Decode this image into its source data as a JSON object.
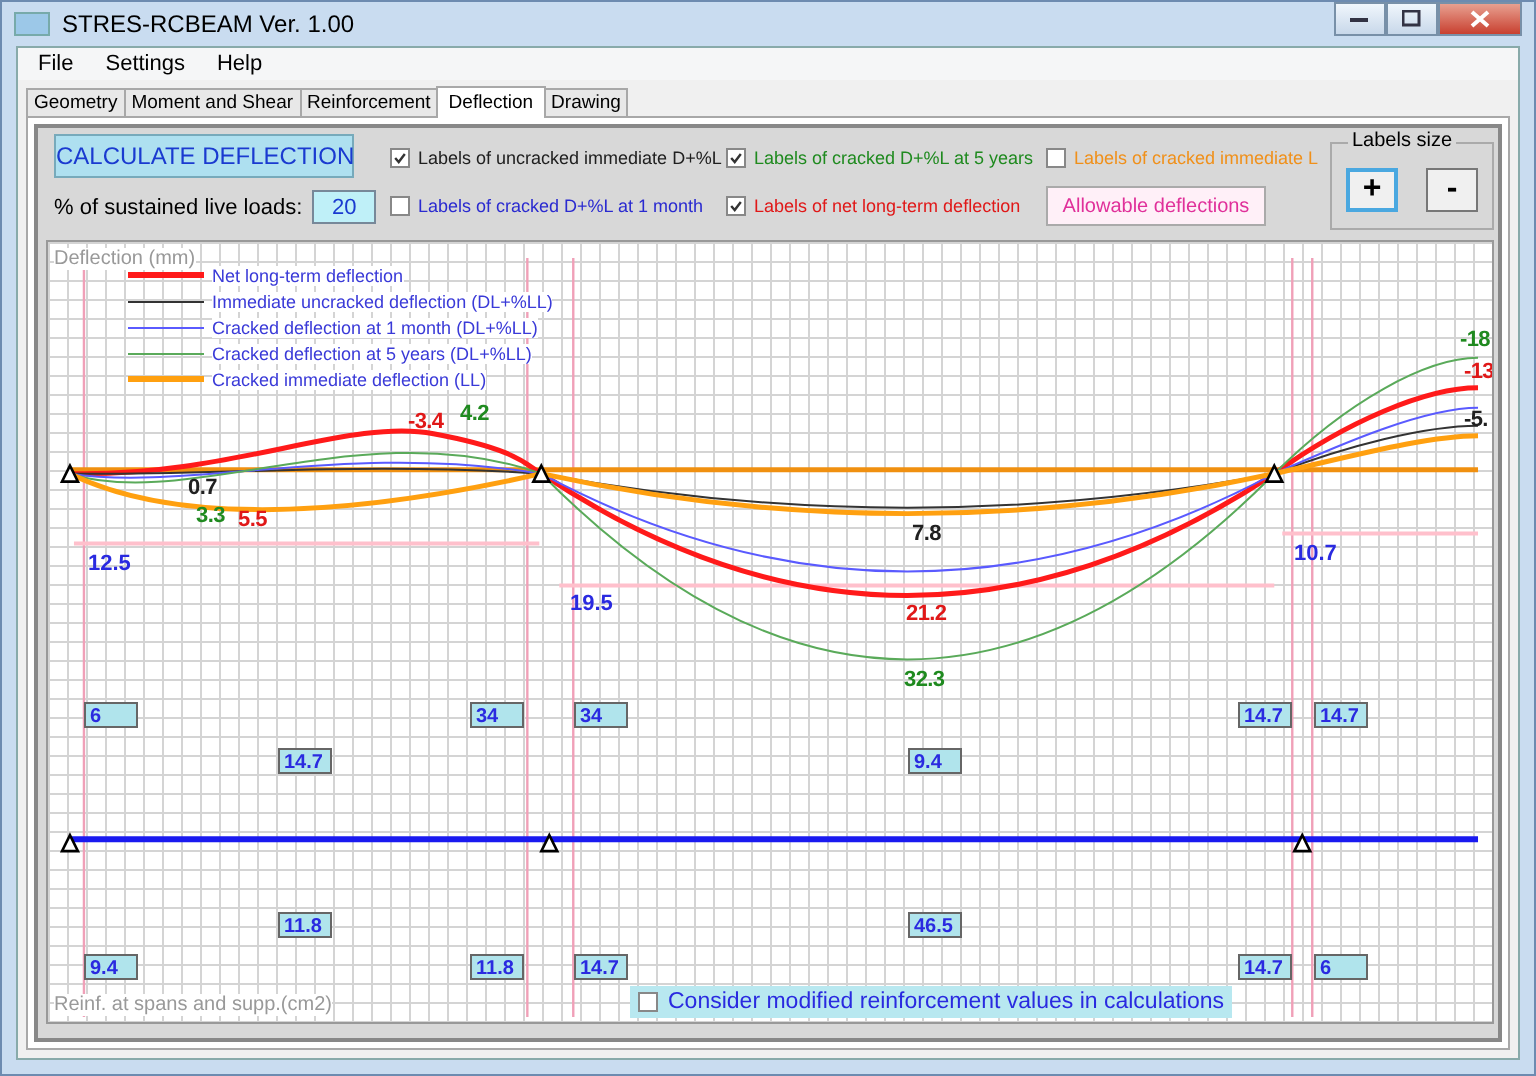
{
  "window": {
    "title": "STRES-RCBEAM Ver. 1.00"
  },
  "menu": [
    "File",
    "Settings",
    "Help"
  ],
  "tabs": [
    {
      "label": "Geometry",
      "selected": false
    },
    {
      "label": "Moment and Shear",
      "selected": false
    },
    {
      "label": "Reinforcement",
      "selected": false
    },
    {
      "label": "Deflection",
      "selected": true
    },
    {
      "label": "Drawing",
      "selected": false
    }
  ],
  "calculate_button": "CALCULATE DEFLECTION",
  "sustained_live_loads": {
    "label": "% of sustained live loads:",
    "value": "20"
  },
  "label_options": [
    {
      "label": "Labels of uncracked immediate D+%L",
      "checked": true,
      "color": "#202020"
    },
    {
      "label": "Labels of cracked D+%L at 1 month",
      "checked": false,
      "color": "#2a2ad0"
    },
    {
      "label": "Labels of cracked D+%L at 5 years",
      "checked": true,
      "color": "#1f8a1f"
    },
    {
      "label": "Labels of net long-term deflection",
      "checked": true,
      "color": "#e01818"
    },
    {
      "label": "Labels of cracked immediate L",
      "checked": false,
      "color": "#f0901a"
    }
  ],
  "allowable_button": "Allowable deflections",
  "labels_size": {
    "title": "Labels size",
    "buttons": [
      "+",
      "-"
    ]
  },
  "chart": {
    "y_axis_label": "Deflection (mm)",
    "legend": [
      {
        "label": "Net long-term deflection",
        "color": "#ff1a1a"
      },
      {
        "label": "Immediate uncracked deflection (DL+%LL)",
        "color": "#333333"
      },
      {
        "label": "Cracked deflection at 1 month (DL+%LL)",
        "color": "#5a5aff"
      },
      {
        "label": "Cracked deflection at 5 years (DL+%LL)",
        "color": "#5aaa5a"
      },
      {
        "label": "Cracked immediate deflection (LL)",
        "color": "#ffa010"
      }
    ],
    "deflection_labels": [
      {
        "text": "0.7",
        "color": "#202020"
      },
      {
        "text": "3.3",
        "color": "#1f8a1f"
      },
      {
        "text": "5.5",
        "color": "#e01818"
      },
      {
        "text": "-3.4",
        "color": "#e01818"
      },
      {
        "text": "4.2",
        "color": "#1f8a1f"
      },
      {
        "text": "7.8",
        "color": "#202020"
      },
      {
        "text": "21.2",
        "color": "#e01818"
      },
      {
        "text": "32.3",
        "color": "#1f8a1f"
      },
      {
        "text": "-18",
        "color": "#1f8a1f"
      },
      {
        "text": "-13",
        "color": "#e01818"
      },
      {
        "text": "-5.",
        "color": "#202020"
      }
    ],
    "allowable_labels": [
      "12.5",
      "19.5",
      "10.7"
    ],
    "reinforcement_label": "Reinf. at spans and supp.(cm2)",
    "reinforcement_values": [
      "6",
      "34",
      "34",
      "14.7",
      "14.7",
      "14.7",
      "9.4",
      "11.8",
      "46.5",
      "9.4",
      "11.8",
      "14.7",
      "14.7",
      "6"
    ],
    "modified_option": {
      "label": "Consider modified reinforcement values in calculations",
      "checked": false
    }
  }
}
